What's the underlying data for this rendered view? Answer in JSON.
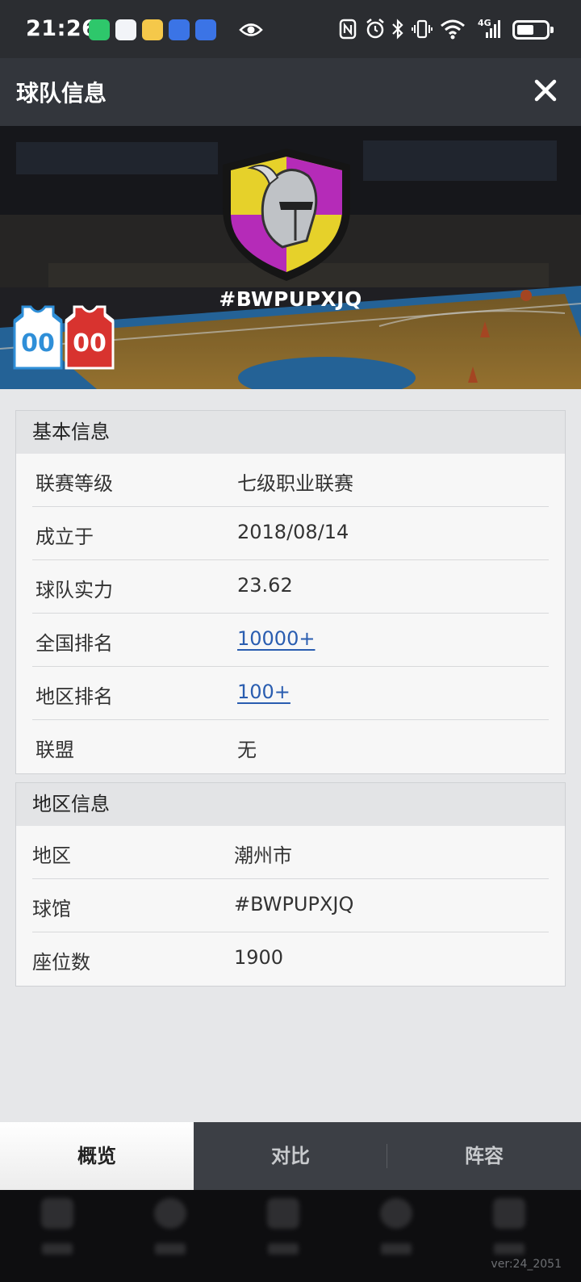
{
  "status_bar": {
    "time": "21:26",
    "network_label": "4G",
    "icons": [
      "nfc-icon",
      "alarm-icon",
      "bluetooth-icon",
      "vibrate-icon",
      "wifi-icon",
      "signal-icon",
      "battery-icon"
    ]
  },
  "header": {
    "title": "球队信息",
    "close_icon": "close-icon"
  },
  "team": {
    "tag": "#BWPUPXJQ",
    "home_jersey_number": "00",
    "away_jersey_number": "00"
  },
  "basic_info": {
    "title": "基本信息",
    "rows": [
      {
        "label": "联赛等级",
        "value": "七级职业联赛",
        "link": false
      },
      {
        "label": "成立于",
        "value": "2018/08/14",
        "link": false
      },
      {
        "label": "球队实力",
        "value": "23.62",
        "link": false
      },
      {
        "label": "全国排名",
        "value": "10000+",
        "link": true
      },
      {
        "label": "地区排名",
        "value": "100+",
        "link": true
      },
      {
        "label": "联盟",
        "value": "无",
        "link": false
      }
    ]
  },
  "region_info": {
    "title": "地区信息",
    "rows": [
      {
        "label": "地区",
        "value": "潮州市"
      },
      {
        "label": "球馆",
        "value": "#BWPUPXJQ"
      },
      {
        "label": "座位数",
        "value": "1900"
      }
    ]
  },
  "tabs": [
    {
      "label": "概览",
      "active": true
    },
    {
      "label": "对比",
      "active": false
    },
    {
      "label": "阵容",
      "active": false
    }
  ],
  "footer": {
    "version": "ver:24_2051"
  },
  "colors": {
    "link": "#2a5db0",
    "header_bg": "#33363c",
    "status_bg": "#2b2d31",
    "shield_yellow": "#e6d12a",
    "shield_purple": "#b52bb8",
    "jersey_blue": "#2f8fd8",
    "jersey_red": "#d8332f"
  }
}
